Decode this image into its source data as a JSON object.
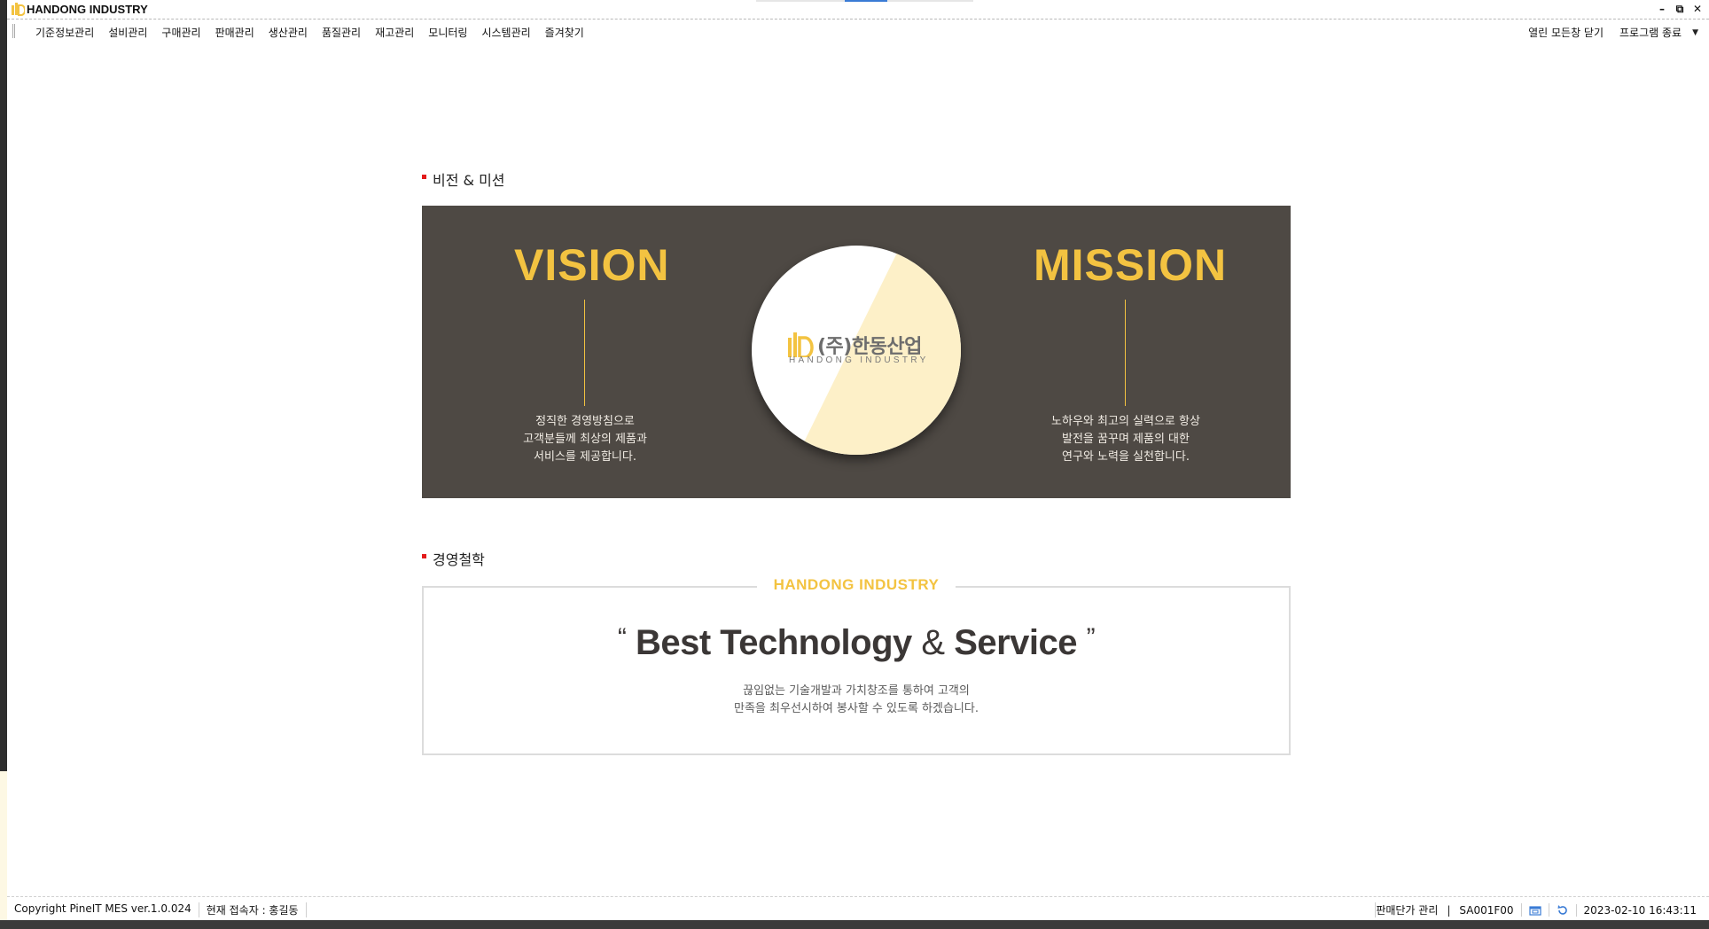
{
  "window": {
    "title": "HANDONG INDUSTRY",
    "minimize_icon": "minimize-icon",
    "restore_icon": "restore-icon",
    "close_icon": "close-icon"
  },
  "menu": {
    "items": [
      "기준정보관리",
      "설비관리",
      "구매관리",
      "판매관리",
      "생산관리",
      "품질관리",
      "재고관리",
      "모니터링",
      "시스템관리",
      "즐겨찾기"
    ],
    "close_all": "열린 모든창 닫기",
    "exit": "프로그램 종료"
  },
  "vision_mission": {
    "section_title": "비전 & 미션",
    "vision_heading": "VISION",
    "vision_text": [
      "정직한 경영방침으로",
      "고객분들께 최상의 제품과",
      "서비스를 제공합니다."
    ],
    "mission_heading": "MISSION",
    "mission_text": [
      "노하우와 최고의 실력으로 항상",
      "발전을 꿈꾸며 제품의 대한",
      "연구와 노력을 실천합니다."
    ],
    "logo_kr": "(주)한동산업",
    "logo_en": "HANDONG INDUSTRY",
    "colors": {
      "panel": "#4e4944",
      "accent": "#f3c341",
      "circle_tint": "#fdf0c8"
    }
  },
  "philosophy": {
    "section_title": "경영철학",
    "brand": "HANDONG INDUSTRY",
    "slogan_open": "“",
    "slogan_part1": "Best Technology",
    "slogan_amp": "&",
    "slogan_part2": "Service",
    "slogan_close": "”",
    "desc_line1": "끊임없는 기술개발과 가치창조를 통하여 고객의",
    "desc_line2": "만족을 최우선시하여 봉사할 수 있도록 하겠습니다."
  },
  "status": {
    "copyright": "Copyright PineIT MES ver.1.0.024",
    "current_user": "현재 접속자 : 홍길동",
    "screen_name": "판매단가 관리",
    "screen_code": "SA001F00",
    "window_icon": "window-icon",
    "refresh_icon": "refresh-icon",
    "datetime": "2023-02-10 16:43:11"
  }
}
